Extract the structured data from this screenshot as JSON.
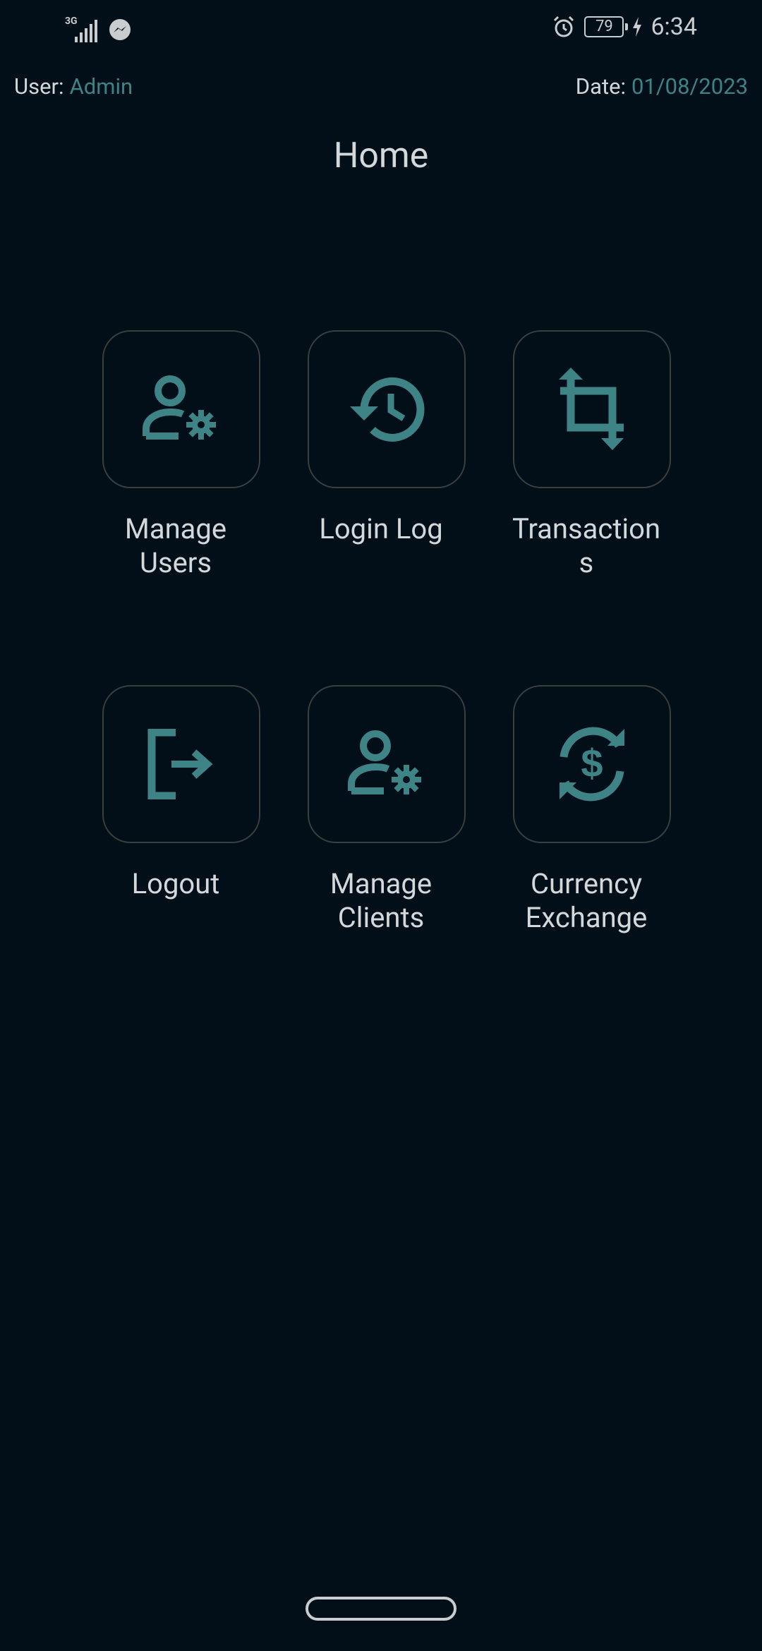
{
  "status_bar": {
    "network": "3G",
    "battery": "79",
    "time": "6:34",
    "icons": [
      "signal-icon",
      "messenger-icon",
      "alarm-icon",
      "battery-icon",
      "charging-icon"
    ]
  },
  "header": {
    "user_label": "User:",
    "user_value": "Admin",
    "date_label": "Date:",
    "date_value": "01/08/2023"
  },
  "page": {
    "title": "Home"
  },
  "tiles": [
    {
      "label": "Manage\nUsers",
      "icon": "manage-accounts-icon"
    },
    {
      "label": "Login Log",
      "icon": "history-icon"
    },
    {
      "label": "Transaction\ns",
      "icon": "crop-icon"
    },
    {
      "label": "Logout",
      "icon": "logout-icon"
    },
    {
      "label": "Manage\nClients",
      "icon": "manage-accounts-icon"
    },
    {
      "label": "Currency\nExchange",
      "icon": "currency-exchange-icon"
    }
  ],
  "colors": {
    "background": "#020f18",
    "accent": "#3e8487",
    "text": "#d4d8da",
    "tile_border": "#3b3f3f"
  }
}
